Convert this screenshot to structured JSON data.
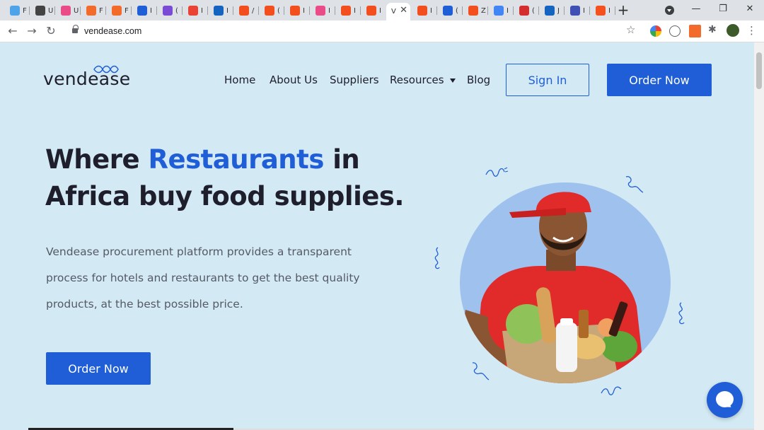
{
  "browser": {
    "tabs": [
      {
        "initial": "F",
        "color": "#4fa3e8"
      },
      {
        "initial": "U",
        "color": "#444444"
      },
      {
        "initial": "U",
        "color": "#ea4c89"
      },
      {
        "initial": "F",
        "color": "#f26b2a"
      },
      {
        "initial": "F",
        "color": "#f26b2a"
      },
      {
        "initial": "I",
        "color": "#1f5ed6"
      },
      {
        "initial": "(",
        "color": "#7b4bd6"
      },
      {
        "initial": "I",
        "color": "#ea4335"
      },
      {
        "initial": "I",
        "color": "#1565c0"
      },
      {
        "initial": "/",
        "color": "#f24e1e"
      },
      {
        "initial": "(",
        "color": "#f24e1e"
      },
      {
        "initial": "I",
        "color": "#f24e1e"
      },
      {
        "initial": "I",
        "color": "#ea4c89"
      },
      {
        "initial": "I",
        "color": "#f24e1e"
      },
      {
        "initial": "I",
        "color": "#f24e1e"
      },
      {
        "initial": "V",
        "color": "#ffffff",
        "active": true
      },
      {
        "initial": "I",
        "color": "#f24e1e"
      },
      {
        "initial": "(",
        "color": "#1f5ed6"
      },
      {
        "initial": "Z",
        "color": "#f24e1e"
      },
      {
        "initial": "I",
        "color": "#4285f4"
      },
      {
        "initial": "(",
        "color": "#d32f2f"
      },
      {
        "initial": "J",
        "color": "#1565c0"
      },
      {
        "initial": "I",
        "color": "#3f51b5"
      },
      {
        "initial": "I",
        "color": "#f4511e"
      }
    ],
    "new_tab": "+",
    "url": "vendease.com",
    "window": {
      "minimize": "—",
      "restore": "❐",
      "close": "✕"
    },
    "nav": {
      "back": "←",
      "forward": "→",
      "reload": "↻"
    },
    "star": "☆",
    "menu": "⋮"
  },
  "site": {
    "logo": "vendease",
    "nav": {
      "home": "Home",
      "about": "About Us",
      "suppliers": "Suppliers",
      "resources": "Resources",
      "blog": "Blog"
    },
    "sign_in": "Sign In",
    "order_now": "Order Now",
    "headline": {
      "pre": "Where ",
      "accent": "Restaurants",
      "post": " in Africa buy food supplies."
    },
    "subtext": "Vendease procurement platform provides a transparent process for hotels and restaurants to get the best quality products, at the best possible price.",
    "cta": "Order Now",
    "icons": {
      "chat": "chat-icon",
      "dropdown": "chevron-down-icon"
    },
    "colors": {
      "background": "#d3e9f3",
      "primary": "#1f5ed6",
      "text": "#1e1e2d",
      "muted": "#555a66",
      "hero_circle": "#9fc1ee"
    }
  }
}
